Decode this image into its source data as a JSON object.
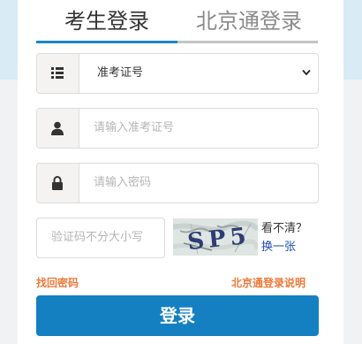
{
  "tabs": {
    "active_label": "考生登录",
    "inactive_label": "北京通登录"
  },
  "form": {
    "id_type_selected": "准考证号",
    "id_number_placeholder": "请输入准考证号",
    "password_placeholder": "请输入密码",
    "captcha_placeholder": "验证码不分大小写",
    "captcha_text": "SP5",
    "refresh_question": "看不清？",
    "refresh_link": "换一张"
  },
  "links": {
    "forgot_password": "找回密码",
    "beijing_login_help": "北京通登录说明"
  },
  "login_button": "登录",
  "colors": {
    "accent": "#1480c2",
    "link_orange": "#ec7a3b"
  },
  "icons": {
    "id_type": "list-icon",
    "id_number": "user-icon",
    "password": "lock-icon"
  }
}
